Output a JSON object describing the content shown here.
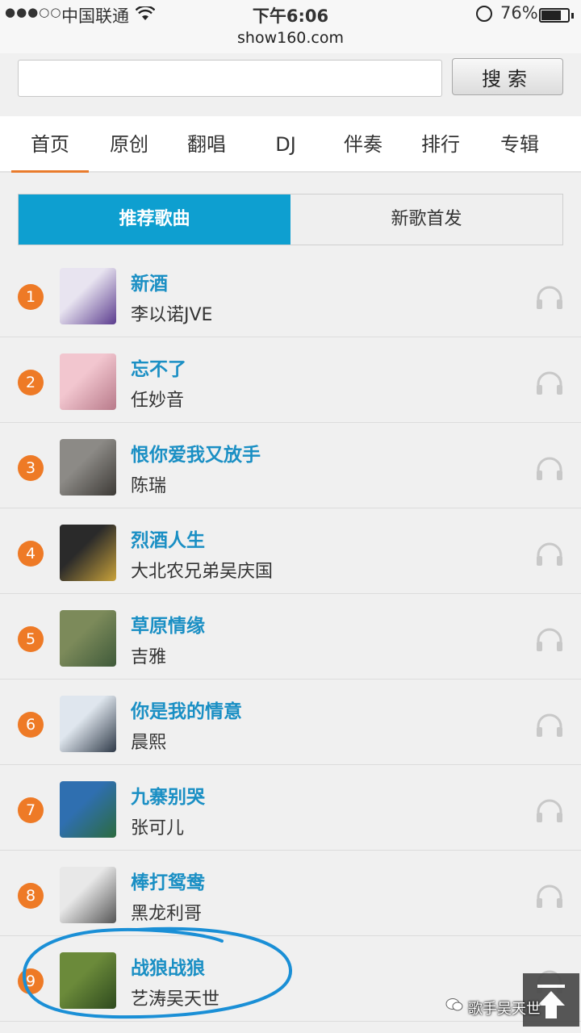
{
  "status_bar": {
    "signal": "●●●○○",
    "carrier": "中国联通",
    "time": "下午6:06",
    "battery_pct": "76%",
    "battery_level": 0.76,
    "url": "show160.com"
  },
  "search": {
    "value": "",
    "button_label": "搜索"
  },
  "nav": {
    "tabs": [
      "首页",
      "原创",
      "翻唱",
      "DJ",
      "伴奏",
      "排行",
      "专辑"
    ],
    "active_index": 0
  },
  "subtabs": {
    "active": "推荐歌曲",
    "inactive": "新歌首发"
  },
  "songs": [
    {
      "rank": "1",
      "title": "新酒",
      "artist": "李以诺JVE"
    },
    {
      "rank": "2",
      "title": "忘不了",
      "artist": "任妙音"
    },
    {
      "rank": "3",
      "title": "恨你爱我又放手",
      "artist": "陈瑞"
    },
    {
      "rank": "4",
      "title": "烈酒人生",
      "artist": "大北农兄弟吴庆国"
    },
    {
      "rank": "5",
      "title": "草原情缘",
      "artist": "吉雅"
    },
    {
      "rank": "6",
      "title": "你是我的情意",
      "artist": "晨熙"
    },
    {
      "rank": "7",
      "title": "九寨别哭",
      "artist": "张可儿"
    },
    {
      "rank": "8",
      "title": "棒打鸳鸯",
      "artist": "黑龙利哥"
    },
    {
      "rank": "9",
      "title": "战狼战狼",
      "artist": "艺涛吴天世"
    }
  ],
  "watermark": "歌手吴天世",
  "colors": {
    "accent_orange": "#ee7a26",
    "accent_blue": "#0e9fd0",
    "title_blue": "#1a8fc4",
    "annotation_circle": "#1a8fd6"
  },
  "cover_colors": [
    [
      "#e8e4f0",
      "#5b3c8e"
    ],
    [
      "#f2c6cf",
      "#b87a8a"
    ],
    [
      "#8c8a86",
      "#3d3a36"
    ],
    [
      "#2a2a2a",
      "#c9a23a"
    ],
    [
      "#7c8a5a",
      "#3f5a3a"
    ],
    [
      "#dfe6ee",
      "#2f3a48"
    ],
    [
      "#2f6fb0",
      "#2c6b3f"
    ],
    [
      "#e8e8e8",
      "#555555"
    ],
    [
      "#6b8a3a",
      "#2e4a1e"
    ]
  ]
}
